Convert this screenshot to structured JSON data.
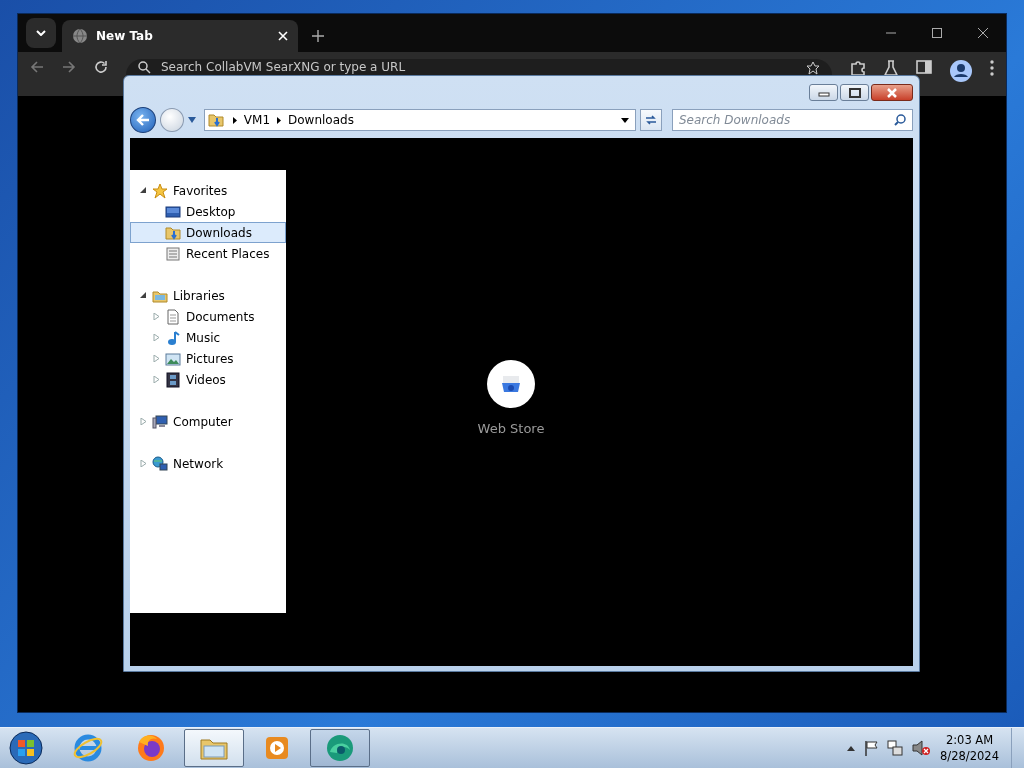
{
  "browser": {
    "tabs": [
      {
        "label": "New Tab",
        "selected": true
      }
    ],
    "address_placeholder": "Search CollabVM SearXNG or type a URL",
    "shortcut": {
      "label": "Web Store"
    }
  },
  "explorer": {
    "breadcrumb": [
      "VM1",
      "Downloads"
    ],
    "search": {
      "placeholder": "Search Downloads"
    },
    "nav_tree": [
      {
        "label": "Favorites",
        "kind": "star",
        "expanded": true,
        "selected": false,
        "children": [
          {
            "label": "Desktop",
            "kind": "desktop",
            "selected": false
          },
          {
            "label": "Downloads",
            "kind": "downloads",
            "selected": true
          },
          {
            "label": "Recent Places",
            "kind": "recent",
            "selected": false
          }
        ]
      },
      {
        "label": "Libraries",
        "kind": "library",
        "expanded": true,
        "selected": false,
        "children": [
          {
            "label": "Documents",
            "kind": "document",
            "expanded": false,
            "selected": false
          },
          {
            "label": "Music",
            "kind": "music",
            "expanded": false,
            "selected": false
          },
          {
            "label": "Pictures",
            "kind": "pictures",
            "expanded": false,
            "selected": false
          },
          {
            "label": "Videos",
            "kind": "videos",
            "expanded": false,
            "selected": false
          }
        ]
      },
      {
        "label": "Computer",
        "kind": "computer",
        "expanded": false,
        "selected": false
      },
      {
        "label": "Network",
        "kind": "network",
        "expanded": false,
        "selected": false
      }
    ]
  },
  "taskbar": {
    "apps": [
      {
        "kind": "ie",
        "running": false,
        "active": false
      },
      {
        "kind": "firefox",
        "running": false,
        "active": false
      },
      {
        "kind": "explorer",
        "running": true,
        "active": true
      },
      {
        "kind": "media",
        "running": false,
        "active": false
      },
      {
        "kind": "browser",
        "running": true,
        "active": false
      }
    ],
    "clock": {
      "time": "2:03 AM",
      "date": "8/28/2024"
    }
  }
}
